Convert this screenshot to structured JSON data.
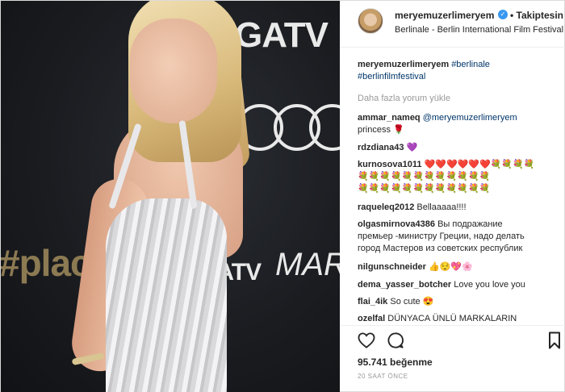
{
  "photo": {
    "brand_top": "GATV",
    "brand_mid": "GATV",
    "placeholder_text": "#placeto",
    "mar_text": "MAR"
  },
  "post": {
    "username": "meryemuzerlimeryem",
    "follow_label": "• Takiptesin",
    "location": "Berlinale - Berlin International Film Festival"
  },
  "caption": {
    "username": "meryemuzerlimeryem",
    "tags_line1": "#berlinale",
    "tags_line2": "#berlinfilmfestival"
  },
  "load_more": "Daha fazla yorum yükle",
  "comments": [
    {
      "user": "ammar_nameq",
      "text": "@meryemuzerlimeryem",
      "line2": "princess 🌹"
    },
    {
      "user": "rdzdiana43",
      "text": "💜"
    },
    {
      "user": "kurnosova1011",
      "text": "❤️❤️❤️❤️❤️❤️💐💐💐💐",
      "line2": "💐💐💐💐💐💐💐💐💐💐💐💐",
      "line3": "💐💐💐💐💐💐💐💐💐💐💐💐"
    },
    {
      "user": "raqueleq2012",
      "text": "Bellaaaaa!!!!"
    },
    {
      "user": "olgasmirnova4386",
      "text": "Вы подражание",
      "line2": "премьер -министру Греции, надо делать",
      "line3": "город Мастеров из советских республик"
    },
    {
      "user": "nilgunschneider",
      "text": "👍😌💖🌸"
    },
    {
      "user": "dema_yasser_botcher",
      "text": "Love you love you"
    },
    {
      "user": "flai_4ik",
      "text": "So cute 😍"
    },
    {
      "user": "ozelfal",
      "text": "DÜNYACA ÜNLÜ MARKALARIN"
    }
  ],
  "likes": "95.741 beğenme",
  "timestamp": "20 SAAT ÖNCE",
  "icons": {
    "verified": "verified-badge-icon",
    "like": "heart-icon",
    "comment": "comment-icon",
    "save": "bookmark-icon"
  },
  "colors": {
    "verified": "#3897f0",
    "link": "#003569",
    "muted": "#999999"
  }
}
